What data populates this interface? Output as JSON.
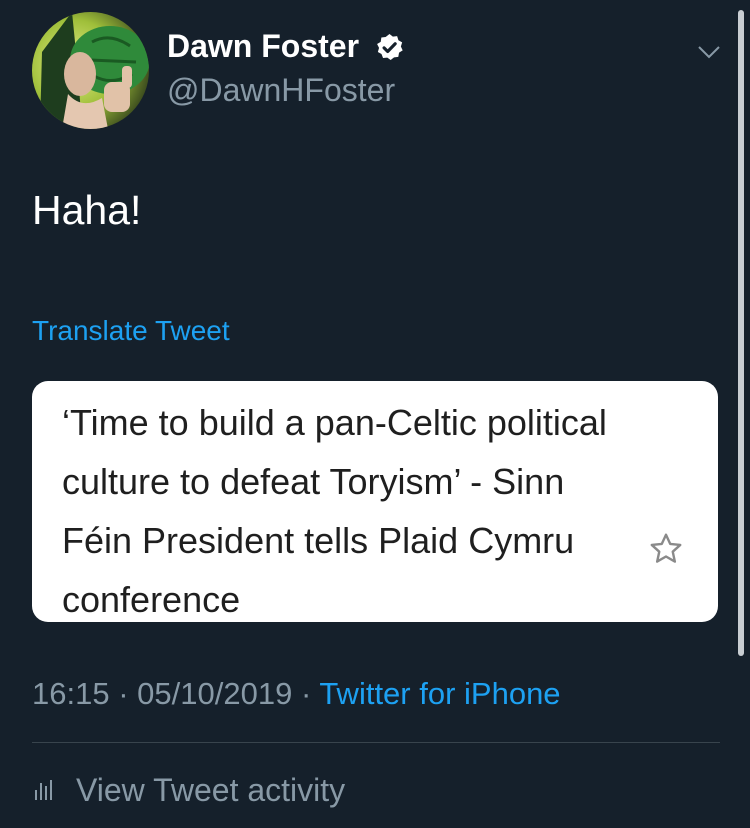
{
  "author": {
    "display_name": "Dawn Foster",
    "handle": "@DawnHFoster"
  },
  "tweet": {
    "text": "Haha!",
    "translate_label": "Translate Tweet",
    "attached_card": {
      "headline": "‘Time to build a pan-Celtic political culture to defeat Toryism’ - Sinn Féin President tells Plaid Cymru conference"
    },
    "time": "16:15",
    "separator": "·",
    "date": "05/10/2019",
    "source": "Twitter for iPhone"
  },
  "footer": {
    "activity_label": "View Tweet activity"
  },
  "icons": {
    "verified": "verified-badge-icon",
    "menu": "chevron-down-icon",
    "card_action": "star-outline-icon",
    "activity": "bar-chart-icon"
  },
  "colors": {
    "background": "#15202b",
    "primary_text": "#ffffff",
    "secondary_text": "#8899a6",
    "link": "#1da1f2",
    "divider": "#38444d",
    "card_background": "#ffffff",
    "card_text": "#1f1f1f"
  }
}
